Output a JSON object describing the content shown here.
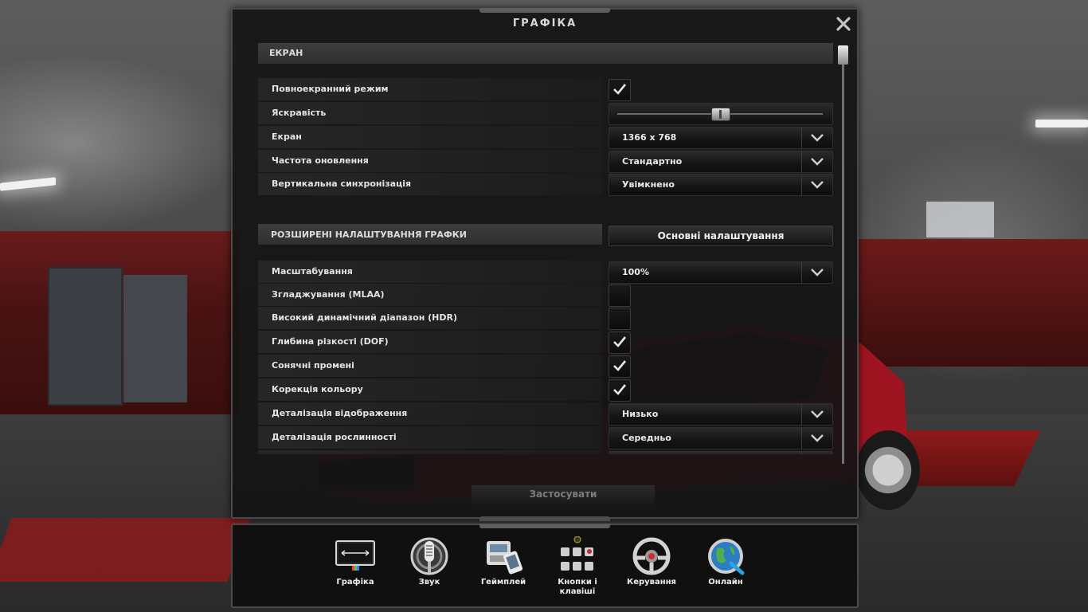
{
  "window": {
    "title": "ГРАФІКА"
  },
  "screen_section": {
    "header": "ЕКРАН",
    "fullscreen": {
      "label": "Повноекранний режим",
      "checked": true
    },
    "brightness": {
      "label": "Яскравість",
      "level": 0.5
    },
    "resolution": {
      "label": "Екран",
      "value": "1366 x 768"
    },
    "refresh_rate": {
      "label": "Частота оновлення",
      "value": "Стандартно"
    },
    "vsync": {
      "label": "Вертикальна синхронізація",
      "value": "Увімкнено"
    }
  },
  "advanced_section": {
    "header": "РОЗШИРЕНІ НАЛАШТУВАННЯ ГРАФКИ",
    "basic_button": "Основні налаштування",
    "scaling": {
      "label": "Масштабування",
      "value": "100%"
    },
    "mlaa": {
      "label": "Згладжування (MLAA)",
      "checked": false
    },
    "hdr": {
      "label": "Високий динамічний діапазон (HDR)",
      "checked": false
    },
    "dof": {
      "label": "Глибина різкості (DOF)",
      "checked": true
    },
    "sun_rays": {
      "label": "Сонячні промені",
      "checked": true
    },
    "color_correction": {
      "label": "Корекція кольору",
      "checked": true
    },
    "detail_level": {
      "label": "Деталізація відображення",
      "value": "Низько"
    },
    "vegetation": {
      "label": "Деталізація рослинності",
      "value": "Середньо"
    }
  },
  "apply_button": "Застосувати",
  "menu": [
    {
      "label": "Графіка",
      "icon": "display-icon"
    },
    {
      "label": "Звук",
      "icon": "microphone-icon"
    },
    {
      "label": "Геймплей",
      "icon": "truck-icon"
    },
    {
      "label": "Кнопки і клавіші",
      "icon": "keyboard-icon"
    },
    {
      "label": "Керування",
      "icon": "steering-wheel-icon"
    },
    {
      "label": "Онлайн",
      "icon": "globe-icon"
    }
  ]
}
